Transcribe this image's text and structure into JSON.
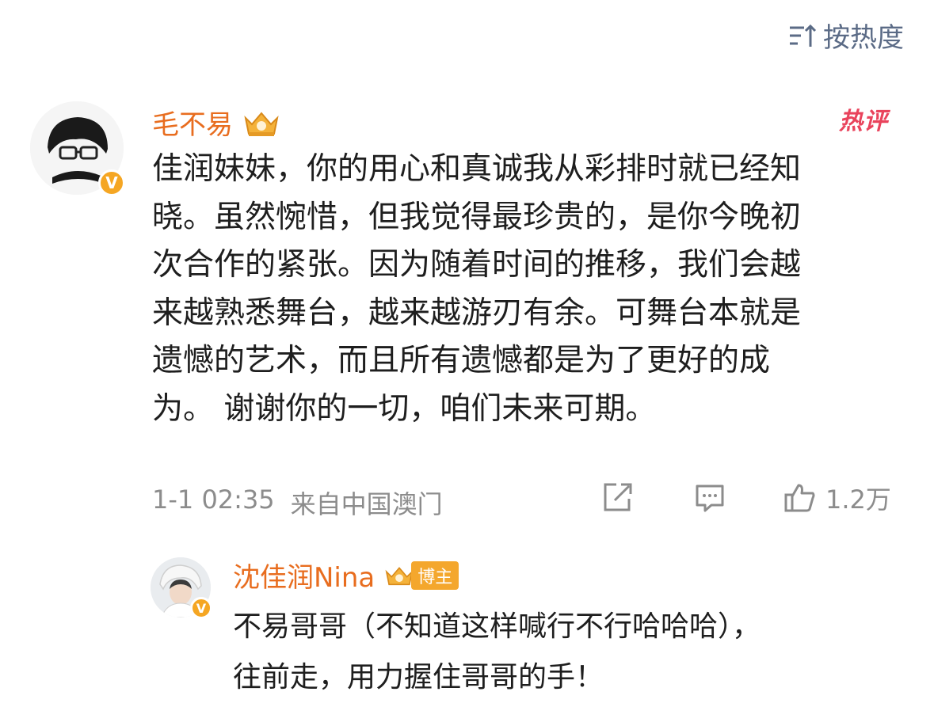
{
  "sort": {
    "label": "按热度",
    "icon": "sort-icon"
  },
  "comment": {
    "author": "毛不易",
    "hot_label": "热评",
    "text_lines": [
      "佳润妹妹，你的用心和真诚我从彩排时就已经知",
      "晓。虽然惋惜，但我觉得最珍贵的，是你今晚初",
      "次合作的紧张。因为随着时间的推移，我们会越",
      "来越熟悉舞台，越来越游刃有余。可舞台本就是",
      "遗憾的艺术，而且所有遗憾都是为了更好的成",
      "为。 谢谢你的一切，咱们未来可期。"
    ],
    "time": "1-1 02:35",
    "location": "来自中国澳门",
    "like_count": "1.2万",
    "badge": "V"
  },
  "reply": {
    "author": "沈佳润Nina",
    "host_label": "博主",
    "text_lines": [
      "不易哥哥（不知道这样喊行不行哈哈哈），",
      "往前走，用力握住哥哥的手！"
    ],
    "badge": "V"
  },
  "colors": {
    "accent": "#e86d1f",
    "hot": "#e9435c",
    "meta": "#8c8c8c",
    "sort": "#5b6b86",
    "vip": "#f5a623"
  }
}
